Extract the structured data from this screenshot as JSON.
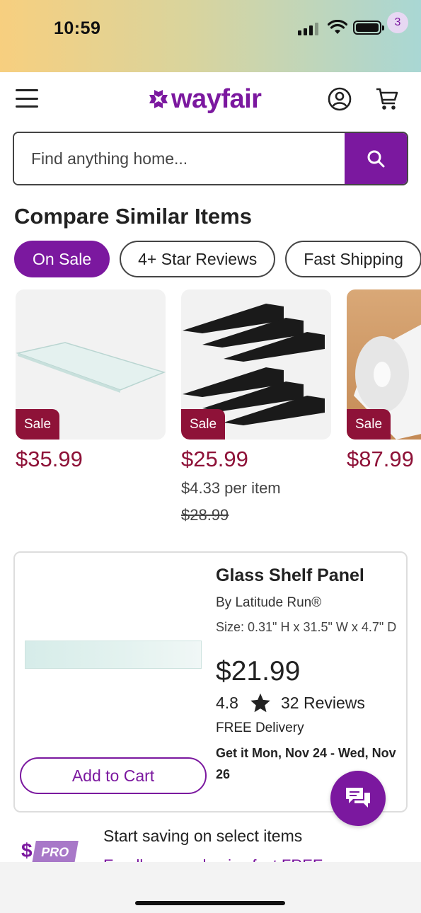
{
  "status_bar": {
    "time": "10:59"
  },
  "header": {
    "logo_text": "wayfair",
    "cart_count": "3",
    "icons": [
      "menu-icon",
      "account-icon",
      "cart-icon"
    ]
  },
  "search": {
    "placeholder": "Find anything home..."
  },
  "section": {
    "title": "Compare Similar Items"
  },
  "chips": [
    "On Sale",
    "4+ Star Reviews",
    "Fast Shipping"
  ],
  "products": [
    {
      "badge": "Sale",
      "price": "$35.99",
      "unit_price": "",
      "original_price": ""
    },
    {
      "badge": "Sale",
      "price": "$25.99",
      "unit_price": "$4.33 per item",
      "original_price": "$28.99"
    },
    {
      "badge": "Sale",
      "price": "$87.99",
      "unit_price": "",
      "original_price": ""
    }
  ],
  "card": {
    "title": "Glass Shelf Panel",
    "brand": "By Latitude Run®",
    "size": "Size: 0.31\" H x 31.5\" W x 4.7\" D",
    "price": "$21.99",
    "rating": "4.8",
    "reviews": "32 Reviews",
    "delivery": "FREE Delivery",
    "delivery_date": "Get it Mon, Nov 24 - Wed, Nov 26",
    "add_to_cart": "Add to Cart"
  },
  "pro_banner": {
    "logo_text": "PRO",
    "logo_symbol": "$",
    "text": "Start saving on select items",
    "subtext": "Enroll now and enjoy fast FREE"
  },
  "colors": {
    "brand": "#7b189f",
    "sale": "#8e1238"
  }
}
